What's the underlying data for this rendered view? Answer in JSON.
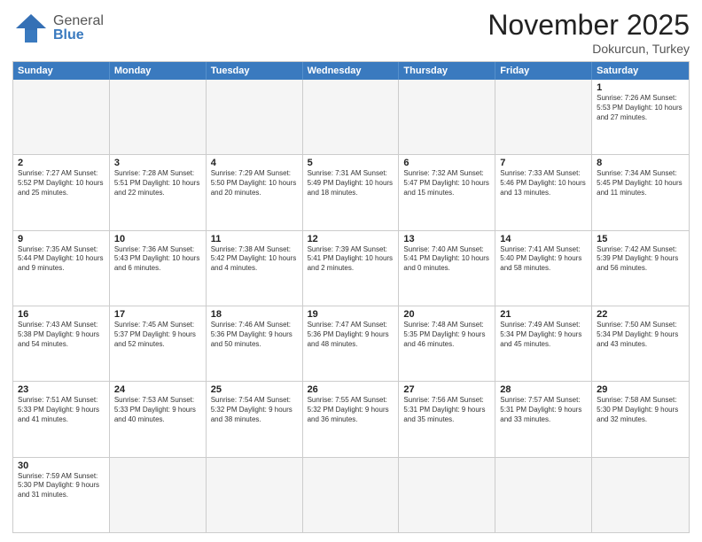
{
  "header": {
    "logo_general": "General",
    "logo_blue": "Blue",
    "title": "November 2025",
    "subtitle": "Dokurcun, Turkey"
  },
  "days": [
    "Sunday",
    "Monday",
    "Tuesday",
    "Wednesday",
    "Thursday",
    "Friday",
    "Saturday"
  ],
  "weeks": [
    [
      {
        "day": "",
        "info": "",
        "empty": true
      },
      {
        "day": "",
        "info": "",
        "empty": true
      },
      {
        "day": "",
        "info": "",
        "empty": true
      },
      {
        "day": "",
        "info": "",
        "empty": true
      },
      {
        "day": "",
        "info": "",
        "empty": true
      },
      {
        "day": "",
        "info": "",
        "empty": true
      },
      {
        "day": "1",
        "info": "Sunrise: 7:26 AM\nSunset: 5:53 PM\nDaylight: 10 hours and 27 minutes.",
        "empty": false
      }
    ],
    [
      {
        "day": "2",
        "info": "Sunrise: 7:27 AM\nSunset: 5:52 PM\nDaylight: 10 hours and 25 minutes.",
        "empty": false
      },
      {
        "day": "3",
        "info": "Sunrise: 7:28 AM\nSunset: 5:51 PM\nDaylight: 10 hours and 22 minutes.",
        "empty": false
      },
      {
        "day": "4",
        "info": "Sunrise: 7:29 AM\nSunset: 5:50 PM\nDaylight: 10 hours and 20 minutes.",
        "empty": false
      },
      {
        "day": "5",
        "info": "Sunrise: 7:31 AM\nSunset: 5:49 PM\nDaylight: 10 hours and 18 minutes.",
        "empty": false
      },
      {
        "day": "6",
        "info": "Sunrise: 7:32 AM\nSunset: 5:47 PM\nDaylight: 10 hours and 15 minutes.",
        "empty": false
      },
      {
        "day": "7",
        "info": "Sunrise: 7:33 AM\nSunset: 5:46 PM\nDaylight: 10 hours and 13 minutes.",
        "empty": false
      },
      {
        "day": "8",
        "info": "Sunrise: 7:34 AM\nSunset: 5:45 PM\nDaylight: 10 hours and 11 minutes.",
        "empty": false
      }
    ],
    [
      {
        "day": "9",
        "info": "Sunrise: 7:35 AM\nSunset: 5:44 PM\nDaylight: 10 hours and 9 minutes.",
        "empty": false
      },
      {
        "day": "10",
        "info": "Sunrise: 7:36 AM\nSunset: 5:43 PM\nDaylight: 10 hours and 6 minutes.",
        "empty": false
      },
      {
        "day": "11",
        "info": "Sunrise: 7:38 AM\nSunset: 5:42 PM\nDaylight: 10 hours and 4 minutes.",
        "empty": false
      },
      {
        "day": "12",
        "info": "Sunrise: 7:39 AM\nSunset: 5:41 PM\nDaylight: 10 hours and 2 minutes.",
        "empty": false
      },
      {
        "day": "13",
        "info": "Sunrise: 7:40 AM\nSunset: 5:41 PM\nDaylight: 10 hours and 0 minutes.",
        "empty": false
      },
      {
        "day": "14",
        "info": "Sunrise: 7:41 AM\nSunset: 5:40 PM\nDaylight: 9 hours and 58 minutes.",
        "empty": false
      },
      {
        "day": "15",
        "info": "Sunrise: 7:42 AM\nSunset: 5:39 PM\nDaylight: 9 hours and 56 minutes.",
        "empty": false
      }
    ],
    [
      {
        "day": "16",
        "info": "Sunrise: 7:43 AM\nSunset: 5:38 PM\nDaylight: 9 hours and 54 minutes.",
        "empty": false
      },
      {
        "day": "17",
        "info": "Sunrise: 7:45 AM\nSunset: 5:37 PM\nDaylight: 9 hours and 52 minutes.",
        "empty": false
      },
      {
        "day": "18",
        "info": "Sunrise: 7:46 AM\nSunset: 5:36 PM\nDaylight: 9 hours and 50 minutes.",
        "empty": false
      },
      {
        "day": "19",
        "info": "Sunrise: 7:47 AM\nSunset: 5:36 PM\nDaylight: 9 hours and 48 minutes.",
        "empty": false
      },
      {
        "day": "20",
        "info": "Sunrise: 7:48 AM\nSunset: 5:35 PM\nDaylight: 9 hours and 46 minutes.",
        "empty": false
      },
      {
        "day": "21",
        "info": "Sunrise: 7:49 AM\nSunset: 5:34 PM\nDaylight: 9 hours and 45 minutes.",
        "empty": false
      },
      {
        "day": "22",
        "info": "Sunrise: 7:50 AM\nSunset: 5:34 PM\nDaylight: 9 hours and 43 minutes.",
        "empty": false
      }
    ],
    [
      {
        "day": "23",
        "info": "Sunrise: 7:51 AM\nSunset: 5:33 PM\nDaylight: 9 hours and 41 minutes.",
        "empty": false
      },
      {
        "day": "24",
        "info": "Sunrise: 7:53 AM\nSunset: 5:33 PM\nDaylight: 9 hours and 40 minutes.",
        "empty": false
      },
      {
        "day": "25",
        "info": "Sunrise: 7:54 AM\nSunset: 5:32 PM\nDaylight: 9 hours and 38 minutes.",
        "empty": false
      },
      {
        "day": "26",
        "info": "Sunrise: 7:55 AM\nSunset: 5:32 PM\nDaylight: 9 hours and 36 minutes.",
        "empty": false
      },
      {
        "day": "27",
        "info": "Sunrise: 7:56 AM\nSunset: 5:31 PM\nDaylight: 9 hours and 35 minutes.",
        "empty": false
      },
      {
        "day": "28",
        "info": "Sunrise: 7:57 AM\nSunset: 5:31 PM\nDaylight: 9 hours and 33 minutes.",
        "empty": false
      },
      {
        "day": "29",
        "info": "Sunrise: 7:58 AM\nSunset: 5:30 PM\nDaylight: 9 hours and 32 minutes.",
        "empty": false
      }
    ],
    [
      {
        "day": "30",
        "info": "Sunrise: 7:59 AM\nSunset: 5:30 PM\nDaylight: 9 hours and 31 minutes.",
        "empty": false
      },
      {
        "day": "",
        "info": "",
        "empty": true
      },
      {
        "day": "",
        "info": "",
        "empty": true
      },
      {
        "day": "",
        "info": "",
        "empty": true
      },
      {
        "day": "",
        "info": "",
        "empty": true
      },
      {
        "day": "",
        "info": "",
        "empty": true
      },
      {
        "day": "",
        "info": "",
        "empty": true
      }
    ]
  ]
}
